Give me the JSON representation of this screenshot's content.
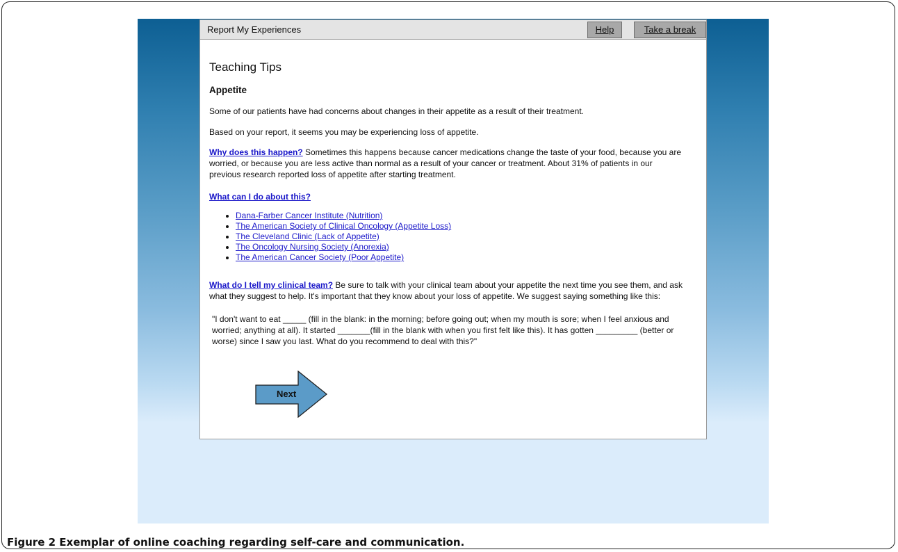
{
  "window": {
    "title": "Report My Experiences",
    "help_label": "Help",
    "break_label": "Take a break"
  },
  "page": {
    "title": "Teaching Tips",
    "section": "Appetite",
    "intro": "Some of our patients have had concerns about changes in their appetite as a result of their treatment.",
    "report": "Based on your report, it seems you may be experiencing loss of appetite.",
    "why_link": "Why does this happen?",
    "why_text": " Sometimes this happens because cancer medications change the taste of your food, because you are worried, or because you are less active than normal as a result of your cancer or treatment. About 31% of patients in our previous research reported loss of appetite after starting treatment.",
    "what_link": "What can I do about this?",
    "resources": [
      "Dana-Farber Cancer Institute (Nutrition)",
      "The American Society of Clinical Oncology (Appetite Loss)",
      "The Cleveland Clinic (Lack of Appetite)",
      "The Oncology Nursing Society (Anorexia)",
      "The American Cancer Society (Poor Appetite)"
    ],
    "tell_link": "What do I tell my clinical team?",
    "tell_text": " Be sure to talk with your clinical team about your appetite the next time you see them, and ask what they suggest to help. It's important that they know about your loss of appetite. We suggest saying something like this:",
    "quote": "\"I don't want to eat _____ (fill in the blank: in the morning; before going out; when my mouth is sore; when I feel anxious and worried; anything at all). It started _______(fill in the blank with when you first felt like this). It has gotten _________ (better or worse) since I saw you last. What do you recommend to deal with this?\"",
    "next_label": "Next"
  },
  "caption": {
    "label": "Figure 2",
    "text": " Exemplar of online coaching regarding self-care and communication."
  },
  "colors": {
    "link": "#1a17c9",
    "next_arrow": "#5b9bc8",
    "gradient_top": "#0d5f93",
    "gradient_bottom": "#dbecfb"
  }
}
